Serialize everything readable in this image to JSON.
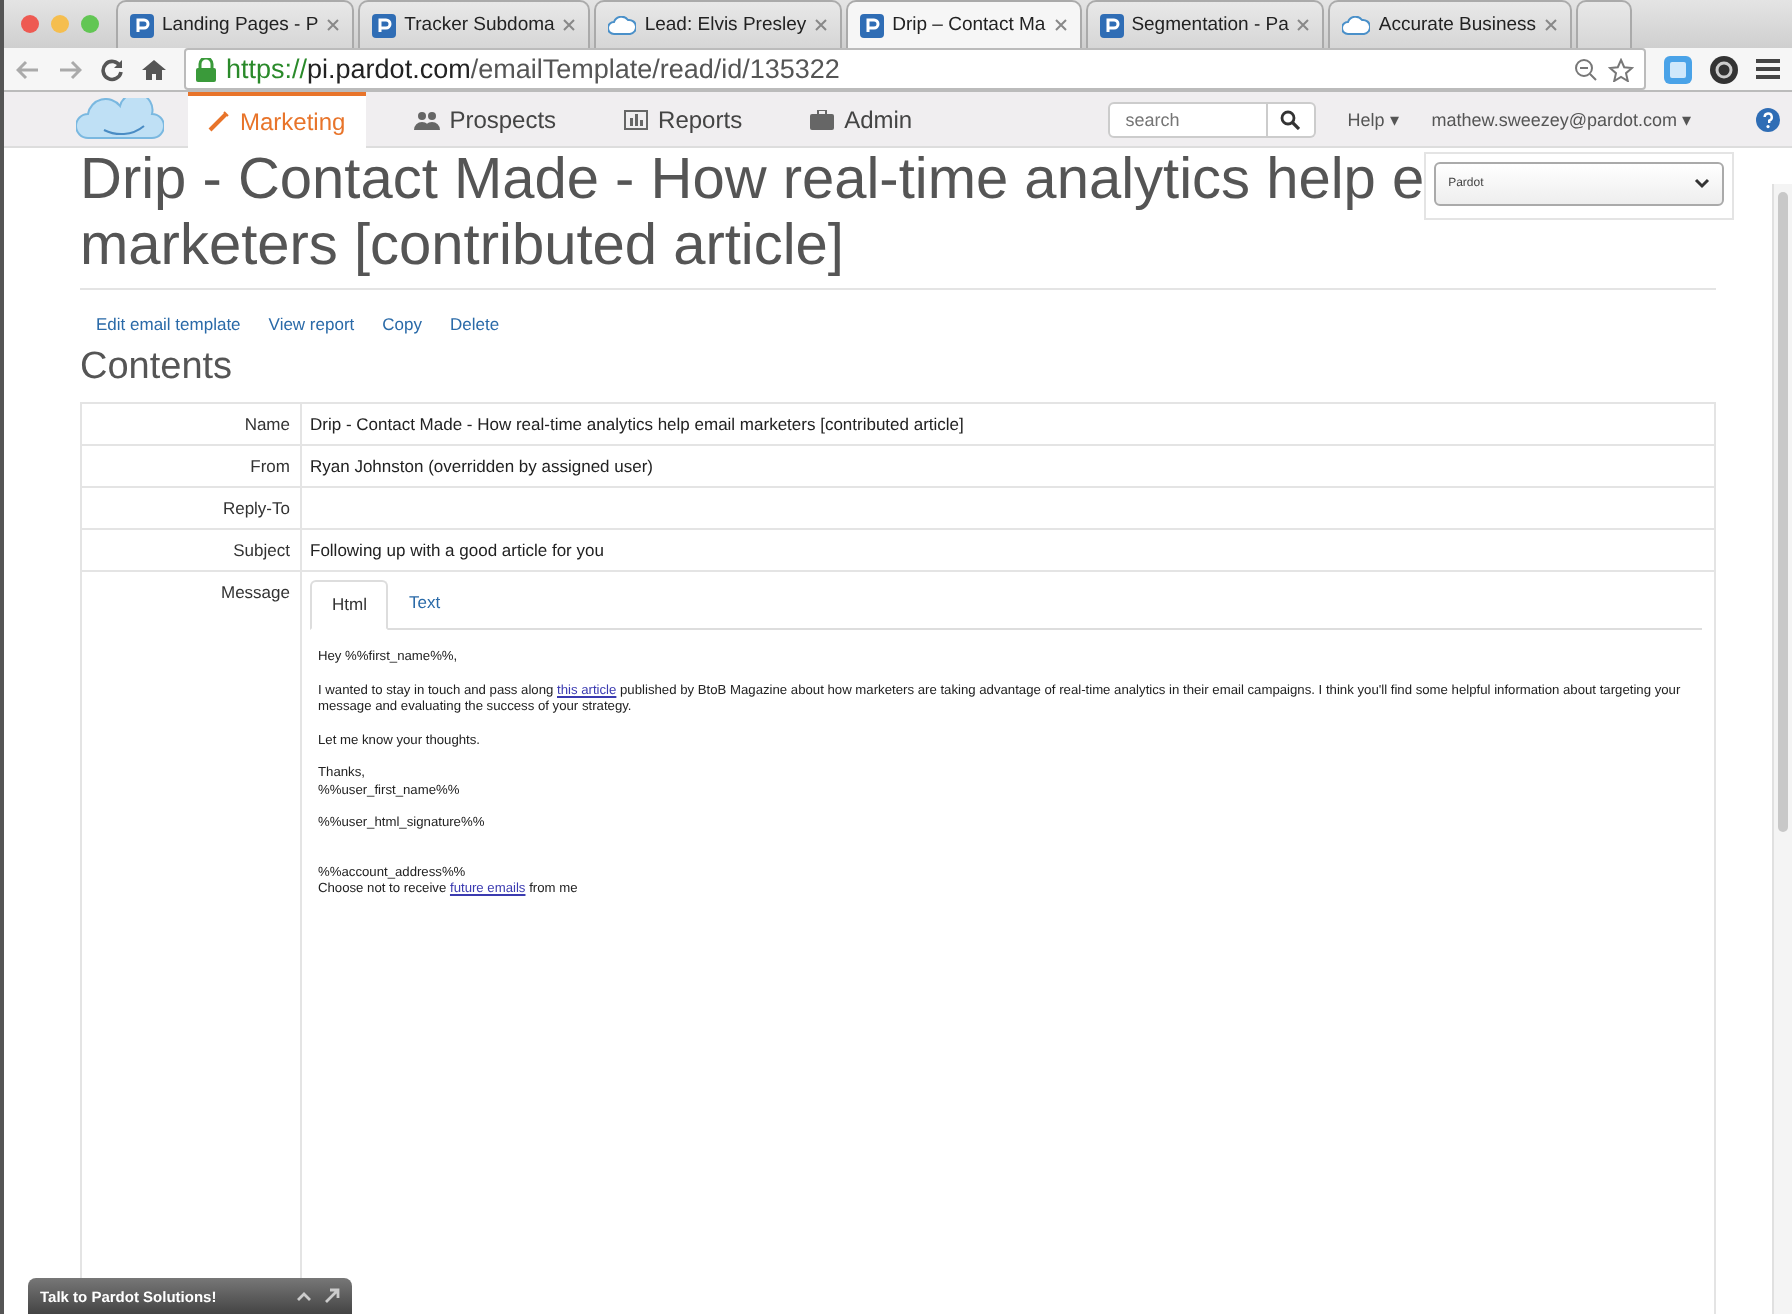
{
  "browser": {
    "tabs": [
      {
        "label": "Landing Pages - P",
        "kind": "pardot",
        "selected": false
      },
      {
        "label": "Tracker Subdoma",
        "kind": "pardot",
        "selected": false
      },
      {
        "label": "Lead: Elvis Presley",
        "kind": "salesforce",
        "selected": false
      },
      {
        "label": "Drip – Contact Ma",
        "kind": "pardot",
        "selected": true
      },
      {
        "label": "Segmentation - Pa",
        "kind": "pardot",
        "selected": false
      },
      {
        "label": "Accurate Business",
        "kind": "salesforce",
        "selected": false
      }
    ],
    "url_scheme": "https://",
    "url_host": "pi.pardot.com",
    "url_path": "/emailTemplate/read/id/135322"
  },
  "nav": {
    "items": [
      {
        "label": "Marketing",
        "selected": true
      },
      {
        "label": "Prospects",
        "selected": false
      },
      {
        "label": "Reports",
        "selected": false
      },
      {
        "label": "Admin",
        "selected": false
      }
    ],
    "search": {
      "placeholder": "search"
    },
    "help": "Help ▾",
    "user": "mathew.sweezey@pardot.com ▾"
  },
  "page": {
    "title_lines": [
      "Drip - Contact Made - How real-time analytics help e",
      "marketers [contributed article]"
    ],
    "dropdown": "Pardot",
    "actions": [
      "Edit email template",
      "View report",
      "Copy",
      "Delete"
    ],
    "section": "Contents",
    "fields": [
      {
        "label": "Name",
        "value": "Drip - Contact Made - How real-time analytics help email marketers [contributed article]"
      },
      {
        "label": "From",
        "value": "Ryan Johnston (overridden by assigned user)"
      },
      {
        "label": "Reply-To"
      },
      {
        "label": "Subject",
        "value": "Following up with a good article for you"
      }
    ],
    "message_label": "Message",
    "message_tabs": [
      {
        "label": "Html",
        "selected": true
      },
      {
        "label": "Text",
        "selected": false
      }
    ],
    "email": [
      {
        "lines": [
          {
            "text": "Hey %%first_name%%,"
          }
        ]
      },
      {
        "lines": [
          {
            "text": "I wanted to stay in touch and pass along ",
            "link": "this article",
            "after": " published by BtoB Magazine about how marketers are taking advantage of real-time analytics in their email campaigns. I think you'll find some helpful information about targeting your message and evaluating the success of your strategy."
          }
        ]
      },
      {
        "lines": [
          {
            "text": "Let me know your thoughts."
          }
        ]
      },
      {
        "lines": [
          {
            "text": "Thanks,"
          },
          {
            "text": "%%user_first_name%%"
          }
        ]
      },
      {
        "lines": [
          {
            "text": "%%user_html_signature%%"
          }
        ]
      },
      {
        "gap": true,
        "lines": [
          {
            "text": "%%account_address%%"
          },
          {
            "text": "Choose not to receive ",
            "link": "future emails",
            "after": " from me"
          }
        ]
      }
    ]
  },
  "chat": {
    "label": "Talk to Pardot Solutions!"
  }
}
